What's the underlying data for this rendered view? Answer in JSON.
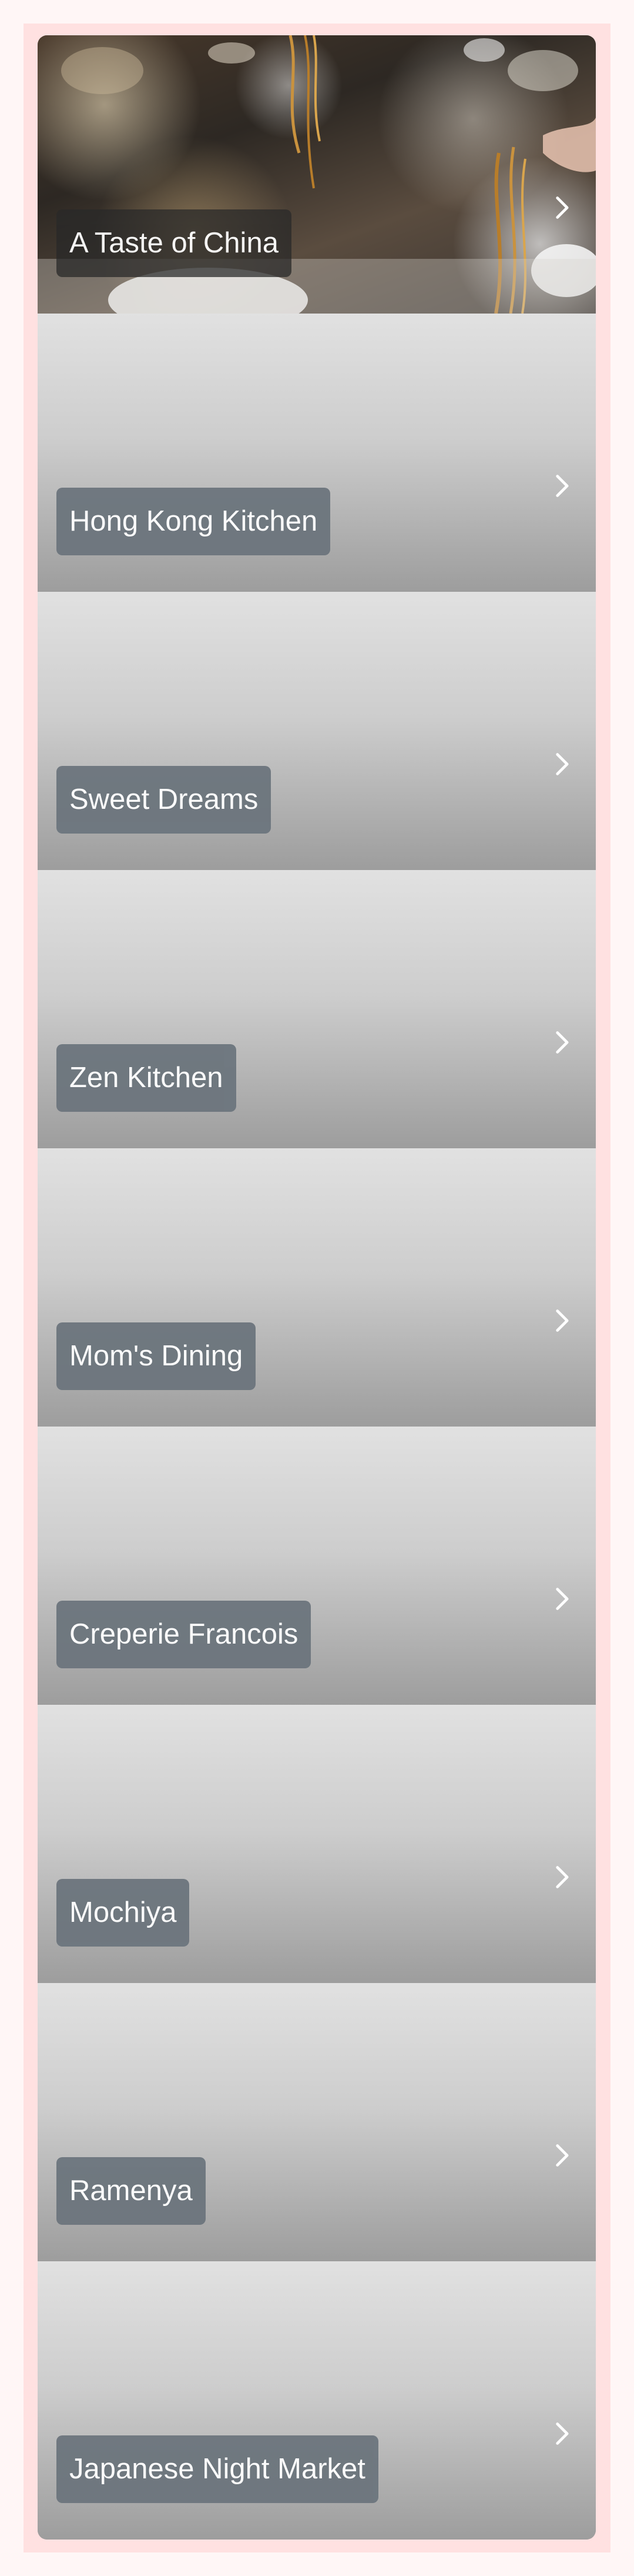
{
  "restaurants": [
    {
      "name": "A Taste of China",
      "icon": "chevron-right-icon"
    },
    {
      "name": "Hong Kong Kitchen",
      "icon": "chevron-right-icon"
    },
    {
      "name": "Sweet Dreams",
      "icon": "chevron-right-icon"
    },
    {
      "name": "Zen Kitchen",
      "icon": "chevron-right-icon"
    },
    {
      "name": "Mom's Dining",
      "icon": "chevron-right-icon"
    },
    {
      "name": "Creperie Francois",
      "icon": "chevron-right-icon"
    },
    {
      "name": "Mochiya",
      "icon": "chevron-right-icon"
    },
    {
      "name": "Ramenya",
      "icon": "chevron-right-icon"
    },
    {
      "name": "Japanese Night Market",
      "icon": "chevron-right-icon"
    }
  ],
  "colors": {
    "page_background": "#fff6f6",
    "frame_background": "#ffe1e1",
    "label_background": "#6c757d",
    "label_text": "#ffffff"
  }
}
